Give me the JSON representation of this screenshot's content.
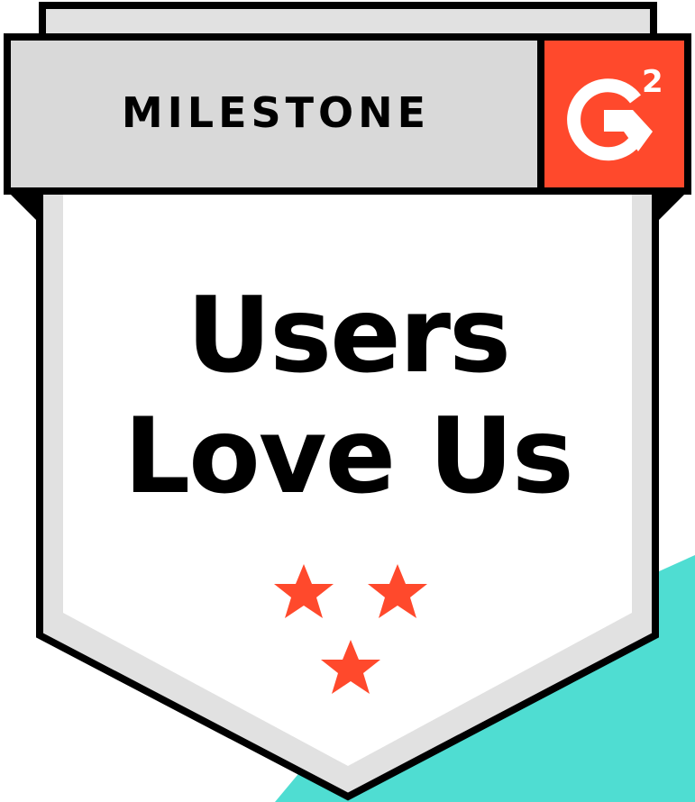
{
  "badge": {
    "ribbon_label": "MILESTONE",
    "logo_text": "G2",
    "headline_line_1": "Users",
    "headline_line_2": "Love Us",
    "star_count": 3,
    "colors": {
      "accent_red": "#FF492C",
      "teal": "#4FDDD2",
      "ribbon_gray": "#D9D9D9",
      "shield_border": "#000000",
      "inner_border_gray": "#E1E1E1"
    },
    "icons": [
      "g2-logo-icon",
      "star-icon"
    ]
  }
}
